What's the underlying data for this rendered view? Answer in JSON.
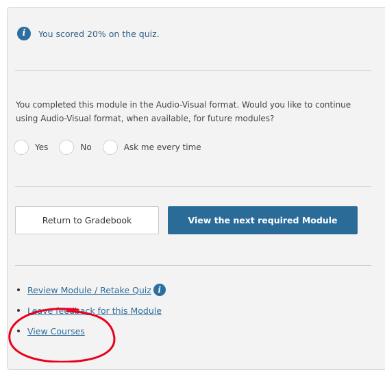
{
  "result": {
    "score_message": "You scored 20% on the quiz.",
    "info_icon": "info-icon"
  },
  "preference": {
    "question": "You completed this module in the Audio-Visual format. Would you like to continue using Audio-Visual format, when available, for future modules?",
    "options": [
      {
        "label": "Yes",
        "selected": false
      },
      {
        "label": "No",
        "selected": false
      },
      {
        "label": "Ask me every time",
        "selected": false
      }
    ]
  },
  "actions": {
    "return_label": "Return to Gradebook",
    "next_label": "View the next required Module"
  },
  "links": [
    {
      "label": "Review Module / Retake Quiz",
      "has_info_icon": true
    },
    {
      "label": "Leave feedback for this Module",
      "has_info_icon": false
    },
    {
      "label": "View Courses",
      "has_info_icon": false
    }
  ],
  "colors": {
    "accent": "#2b6b98",
    "link": "#2c6c9c",
    "annotation": "#e8001c"
  }
}
